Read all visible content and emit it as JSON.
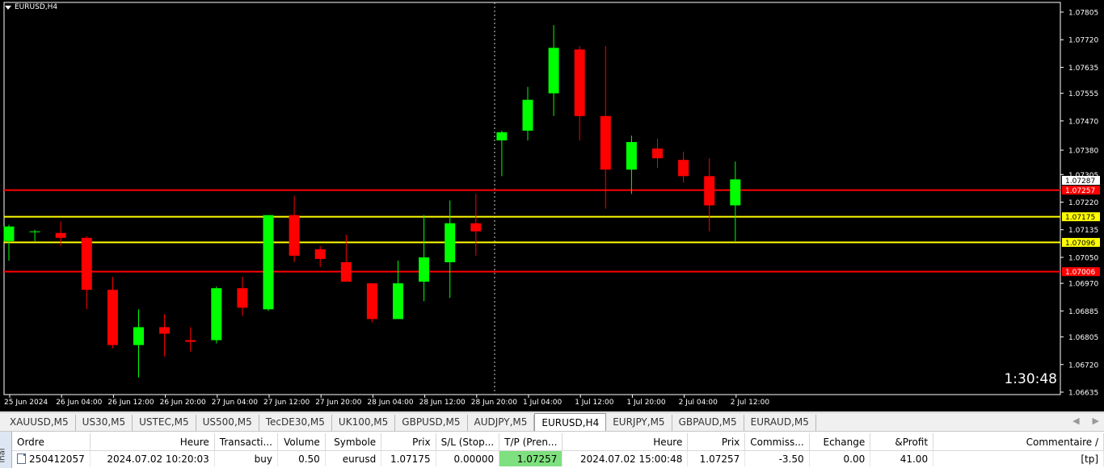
{
  "chart": {
    "symbol_title": "EURUSD,H4",
    "countdown": "1:30:48",
    "price_ticks": [
      "1.07805",
      "1.07720",
      "1.07635",
      "1.07555",
      "1.07470",
      "1.07380",
      "1.07305",
      "1.07220",
      "1.07135",
      "1.07050",
      "1.06970",
      "1.06885",
      "1.06805",
      "1.06720",
      "1.06635"
    ],
    "time_ticks": [
      "25 Jun 2024",
      "26 Jun 04:00",
      "26 Jun 12:00",
      "26 Jun 20:00",
      "27 Jun 04:00",
      "27 Jun 12:00",
      "27 Jun 20:00",
      "28 Jun 04:00",
      "28 Jun 12:00",
      "28 Jun 20:00",
      "1 Jul 04:00",
      "1 Jul 12:00",
      "1 Jul 20:00",
      "2 Jul 04:00",
      "2 Jul 12:00"
    ],
    "hlines": [
      {
        "price": 1.07257,
        "label": "1.07257",
        "color": "#ff0000",
        "label_bg": "#ff0000",
        "label_fg": "#ffffff"
      },
      {
        "price": 1.07175,
        "label": "1.07175",
        "color": "#ffff00",
        "label_bg": "#ffff00",
        "label_fg": "#000000"
      },
      {
        "price": 1.07096,
        "label": "1.07096",
        "color": "#ffff00",
        "label_bg": "#ffff00",
        "label_fg": "#000000"
      },
      {
        "price": 1.07006,
        "label": "1.07006",
        "color": "#ff0000",
        "label_bg": "#ff0000",
        "label_fg": "#ffffff"
      }
    ],
    "current_price": {
      "price": 1.07287,
      "label": "1.07287"
    },
    "bull_color": "#00ff00",
    "bear_color": "#ff0000",
    "candles": [
      [
        1.071,
        1.0715,
        1.0704,
        1.07145
      ],
      [
        1.0713,
        1.07135,
        1.071,
        1.0713
      ],
      [
        1.07125,
        1.0716,
        1.07085,
        1.0711
      ],
      [
        1.0711,
        1.07115,
        1.0689,
        1.0695
      ],
      [
        1.0695,
        1.0699,
        1.0677,
        1.0678
      ],
      [
        1.0678,
        1.0689,
        1.0668,
        1.06835
      ],
      [
        1.06835,
        1.06875,
        1.06745,
        1.06815
      ],
      [
        1.06795,
        1.06835,
        1.0676,
        1.0679
      ],
      [
        1.06795,
        1.0696,
        1.06785,
        1.06955
      ],
      [
        1.06955,
        1.0699,
        1.0687,
        1.06895
      ],
      [
        1.0689,
        1.0718,
        1.06885,
        1.0718
      ],
      [
        1.0718,
        1.0724,
        1.07035,
        1.07055
      ],
      [
        1.07075,
        1.07085,
        1.0702,
        1.07045
      ],
      [
        1.07035,
        1.0712,
        1.06975,
        1.06975
      ],
      [
        1.0697,
        1.0697,
        1.0685,
        1.0686
      ],
      [
        1.0686,
        1.0704,
        1.0686,
        1.0697
      ],
      [
        1.06975,
        1.0718,
        1.06915,
        1.0705
      ],
      [
        1.07035,
        1.07225,
        1.06925,
        1.07155
      ],
      [
        1.07155,
        1.07245,
        1.07055,
        1.0713
      ],
      [
        1.0741,
        1.0744,
        1.073,
        1.07435
      ],
      [
        1.0744,
        1.07575,
        1.0741,
        1.07535
      ],
      [
        1.07555,
        1.07765,
        1.07485,
        1.07695
      ],
      [
        1.0769,
        1.077,
        1.0741,
        1.07485
      ],
      [
        1.07485,
        1.077,
        1.072,
        1.0732
      ],
      [
        1.0732,
        1.07425,
        1.07245,
        1.07405
      ],
      [
        1.07385,
        1.07415,
        1.07325,
        1.07355
      ],
      [
        1.0735,
        1.07375,
        1.0728,
        1.073
      ],
      [
        1.073,
        1.07355,
        1.0713,
        1.0721
      ],
      [
        1.0721,
        1.07345,
        1.071,
        1.0729
      ]
    ]
  },
  "tabs": [
    "XAUUSD,M5",
    "US30,M5",
    "USTEC,M5",
    "US500,M5",
    "TecDE30,M5",
    "UK100,M5",
    "GBPUSD,M5",
    "AUDJPY,M5",
    "EURUSD,H4",
    "EURJPY,M5",
    "GBPAUD,M5",
    "EURAUD,M5"
  ],
  "active_tab": "EURUSD,H4",
  "terminal": {
    "side_label": "inal",
    "columns": [
      "Ordre",
      "Heure",
      "Transacti...",
      "Volume",
      "Symbole",
      "Prix",
      "S/L (Stop...",
      "T/P (Pren...",
      "Heure",
      "Prix",
      "Commiss...",
      "Echange",
      "&Profit",
      "Commentaire"
    ],
    "rows": [
      [
        "250412057",
        "2024.07.02 10:20:03",
        "buy",
        "0.50",
        "eurusd",
        "1.07175",
        "0.00000",
        "1.07257",
        "2024.07.02 15:00:48",
        "1.07257",
        "-3.50",
        "0.00",
        "41.00",
        "[tp]"
      ]
    ]
  }
}
